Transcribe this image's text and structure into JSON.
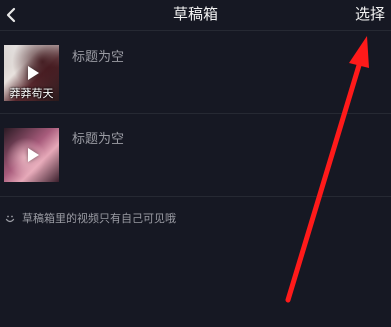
{
  "header": {
    "title": "草稿箱",
    "select_label": "选择",
    "back_icon": "chevron-left-icon"
  },
  "drafts": [
    {
      "title": "标题为空",
      "thumbnail_caption": "莽莽苟天"
    },
    {
      "title": "标题为空",
      "thumbnail_caption": ""
    }
  ],
  "footer": {
    "note": "草稿箱里的视频只有自己可见哦",
    "icon": "smile-icon"
  },
  "annotation": {
    "arrow_color": "#ff1a1a"
  },
  "colors": {
    "background": "#161823",
    "divider": "#262933",
    "muted_text": "#9a9ba3"
  }
}
